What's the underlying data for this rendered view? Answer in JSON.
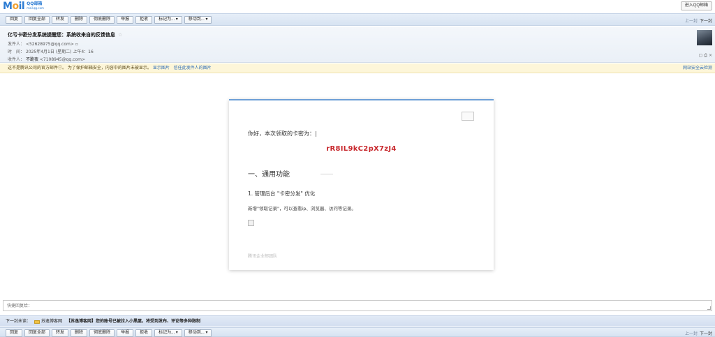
{
  "topbar": {
    "logo_text_a": "M",
    "logo_text_o": "o",
    "logo_text_b": "il",
    "logo_cn": "QQ邮箱",
    "logo_url": "mail.qq.com",
    "enter_button": "进入QQ邮箱"
  },
  "toolbar": {
    "buttons": [
      "回复",
      "回复全部",
      "转发",
      "删除",
      "彻底删除",
      "举报",
      "拒收",
      "标记为... ▾",
      "移动到... ▾"
    ],
    "prev": "上一封",
    "next": "下一封"
  },
  "header": {
    "subject": "亿亏卡密分发系统提醒您：系统收来自的反馈信息",
    "star": "☆",
    "from_label": "发件人：",
    "from_value": "<52628975@qq.com>",
    "time_label": "时　间：",
    "time_value": "2025年4月1日 (星期二) 上午4：16",
    "to_label": "收件人：",
    "to_name": "不跪夜",
    "to_value": "<7108945@qq.com>"
  },
  "warning": {
    "text": "这不是腾讯公司的官方邮件ⓘ。 为了保护邮箱安全，内容中的图片未被显示。",
    "show_images": "显示图片",
    "trust_sender": "信任此发件人的图片",
    "right_link": "网站安全云检测"
  },
  "email": {
    "greeting": "你好，本次领取的卡密为：|",
    "code": "rR8IL9kC2pX7zJ4",
    "section_title": "一、通用功能",
    "item1_title": "1. 管理后台 \"卡密分发\" 优化",
    "item1_desc": "新增\"领取记录\"，可以查看ip、浏览器、访问等记录。",
    "footer": "腾讯企业邮团队"
  },
  "reply": {
    "placeholder": "快捷回复给："
  },
  "next_mail": {
    "label": "下一封未读：",
    "sender": "苏逸博客网",
    "subject": "【苏逸博客网】您的账号已被拉入小黑屋，将受到发布、评论等多种限制"
  }
}
